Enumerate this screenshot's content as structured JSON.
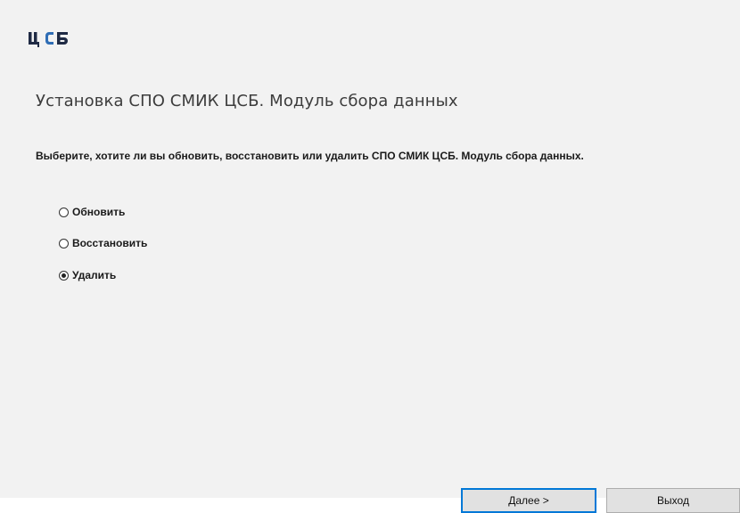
{
  "window": {
    "logo_text": "ЦСБ",
    "title": "Установка СПО СМИК ЦСБ. Модуль сбора данных"
  },
  "main": {
    "prompt": "Выберите, хотите ли вы обновить, восстановить или удалить СПО СМИК ЦСБ. Модуль сбора данных.",
    "options": [
      {
        "label": "Обновить",
        "checked": false
      },
      {
        "label": "Восстановить",
        "checked": false
      },
      {
        "label": "Удалить",
        "checked": true
      }
    ]
  },
  "buttons": {
    "next": "Далее >",
    "exit": "Выход"
  },
  "colors": {
    "background": "#f2f2f2",
    "primary_border": "#0078d7",
    "logo_dark": "#1f2a44",
    "logo_blue": "#2f6db5"
  },
  "icons": [
    "logo-icon",
    "radio-icon"
  ]
}
